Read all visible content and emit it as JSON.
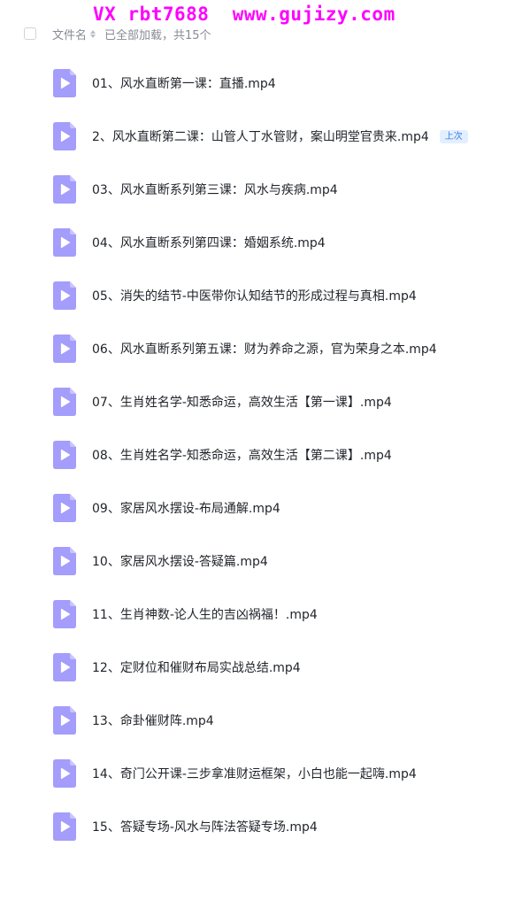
{
  "watermark": "VX rbt7688  www.gujizy.com",
  "header": {
    "filename_label": "文件名",
    "status_text": "已全部加载，共15个"
  },
  "colors": {
    "video_icon": "#a49dfb",
    "badge_bg": "#e2efff",
    "badge_text": "#3f7de0",
    "watermark": "#ff00ff"
  },
  "files": [
    {
      "name": "01、风水直断第一课：直播.mp4",
      "icon": "video-file-icon"
    },
    {
      "name": "2、风水直断第二课：山管人丁水管财，案山明堂官贵来.mp4",
      "icon": "video-file-icon",
      "badge": "上次"
    },
    {
      "name": "03、风水直断系列第三课：风水与疾病.mp4",
      "icon": "video-file-icon"
    },
    {
      "name": "04、风水直断系列第四课：婚姻系统.mp4",
      "icon": "video-file-icon"
    },
    {
      "name": "05、消失的结节-中医带你认知结节的形成过程与真相.mp4",
      "icon": "video-file-icon"
    },
    {
      "name": "06、风水直断系列第五课：财为养命之源，官为荣身之本.mp4",
      "icon": "video-file-icon"
    },
    {
      "name": "07、生肖姓名学-知悉命运，高效生活【第一课】.mp4",
      "icon": "video-file-icon"
    },
    {
      "name": "08、生肖姓名学-知悉命运，高效生活【第二课】.mp4",
      "icon": "video-file-icon"
    },
    {
      "name": "09、家居风水摆设-布局通解.mp4",
      "icon": "video-file-icon"
    },
    {
      "name": "10、家居风水摆设-答疑篇.mp4",
      "icon": "video-file-icon"
    },
    {
      "name": "11、生肖神数-论人生的吉凶祸福！.mp4",
      "icon": "video-file-icon"
    },
    {
      "name": "12、定财位和催财布局实战总结.mp4",
      "icon": "video-file-icon"
    },
    {
      "name": "13、命卦催财阵.mp4",
      "icon": "video-file-icon"
    },
    {
      "name": "14、奇门公开课-三步拿准财运框架，小白也能一起嗨.mp4",
      "icon": "video-file-icon"
    },
    {
      "name": "15、答疑专场-风水与阵法答疑专场.mp4",
      "icon": "video-file-icon"
    }
  ]
}
